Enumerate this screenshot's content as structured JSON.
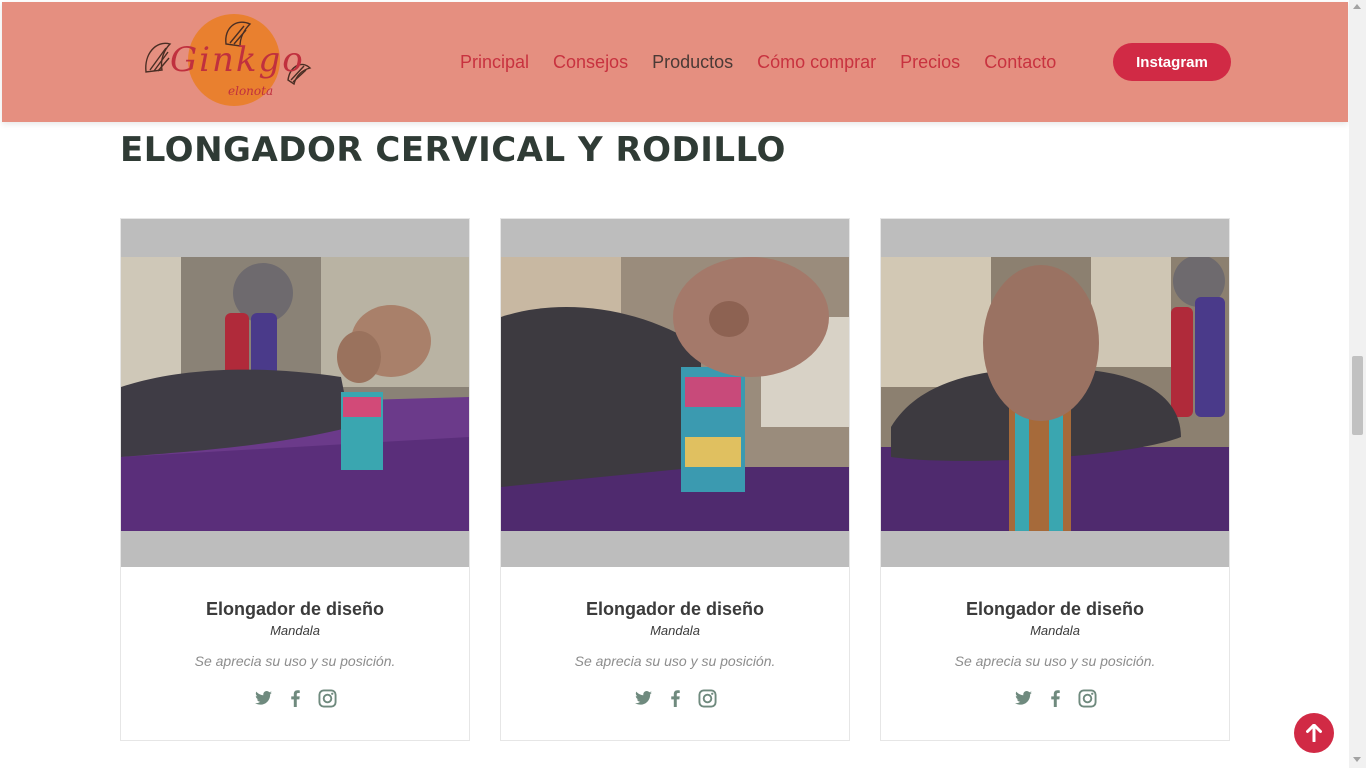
{
  "brand": {
    "logo_text": "Ginkgo",
    "logo_sub": "elonota"
  },
  "nav": {
    "items": [
      {
        "label": "Principal"
      },
      {
        "label": "Consejos"
      },
      {
        "label": "Productos"
      },
      {
        "label": "Cómo comprar"
      },
      {
        "label": "Precios"
      },
      {
        "label": "Contacto"
      }
    ],
    "instagram_button": "Instagram"
  },
  "section": {
    "title": "ELONGADOR CERVICAL Y RODILLO"
  },
  "cards": [
    {
      "name": "Elongador de diseño",
      "subtitle": "Mandala",
      "description": "Se aprecia su uso y su posición.",
      "icons": [
        "twitter-icon",
        "facebook-icon",
        "instagram-icon"
      ]
    },
    {
      "name": "Elongador de diseño",
      "subtitle": "Mandala",
      "description": "Se aprecia su uso y su posición.",
      "icons": [
        "twitter-icon",
        "facebook-icon",
        "instagram-icon"
      ]
    },
    {
      "name": "Elongador de diseño",
      "subtitle": "Mandala",
      "description": "Se aprecia su uso y su posición.",
      "icons": [
        "twitter-icon",
        "facebook-icon",
        "instagram-icon"
      ]
    }
  ],
  "colors": {
    "header_bg": "#e58f80",
    "accent": "#d12a45",
    "nav_link": "#c8323f",
    "nav_active": "#4a3a36",
    "title": "#2f3b35",
    "icon": "#6f8a7e"
  },
  "back_to_top_icon": "arrow-up-icon"
}
